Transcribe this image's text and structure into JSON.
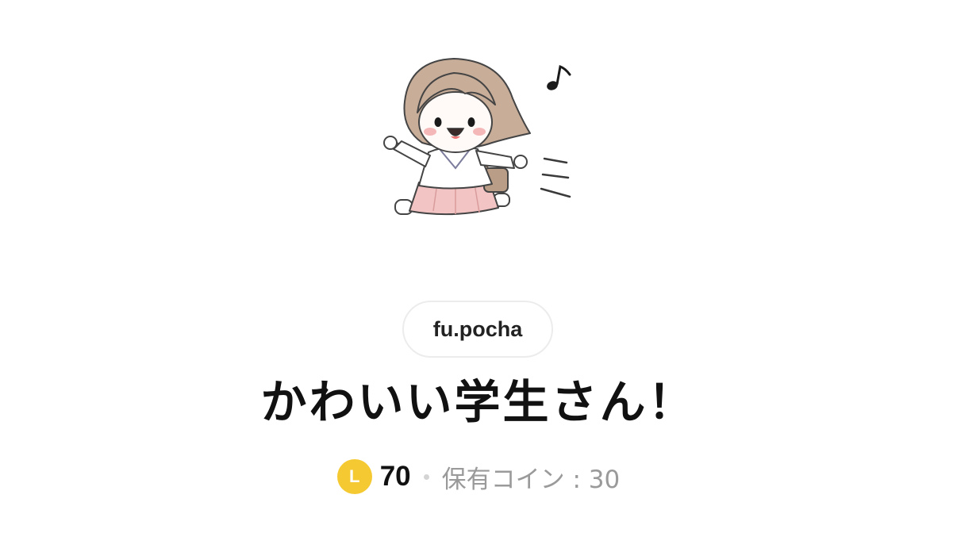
{
  "author": {
    "name": "fu.pocha"
  },
  "sticker": {
    "title": "かわいい学生さん！"
  },
  "pricing": {
    "coin_symbol": "L",
    "price": "70",
    "owned_coins_text": "保有コイン : 30"
  },
  "colors": {
    "coin": "#f5c931",
    "skirt": "#f3c4c4",
    "hair": "#c8ad99",
    "bag": "#b99d86"
  },
  "icons": [
    "music-note-icon",
    "motion-lines-icon",
    "coin-icon"
  ]
}
